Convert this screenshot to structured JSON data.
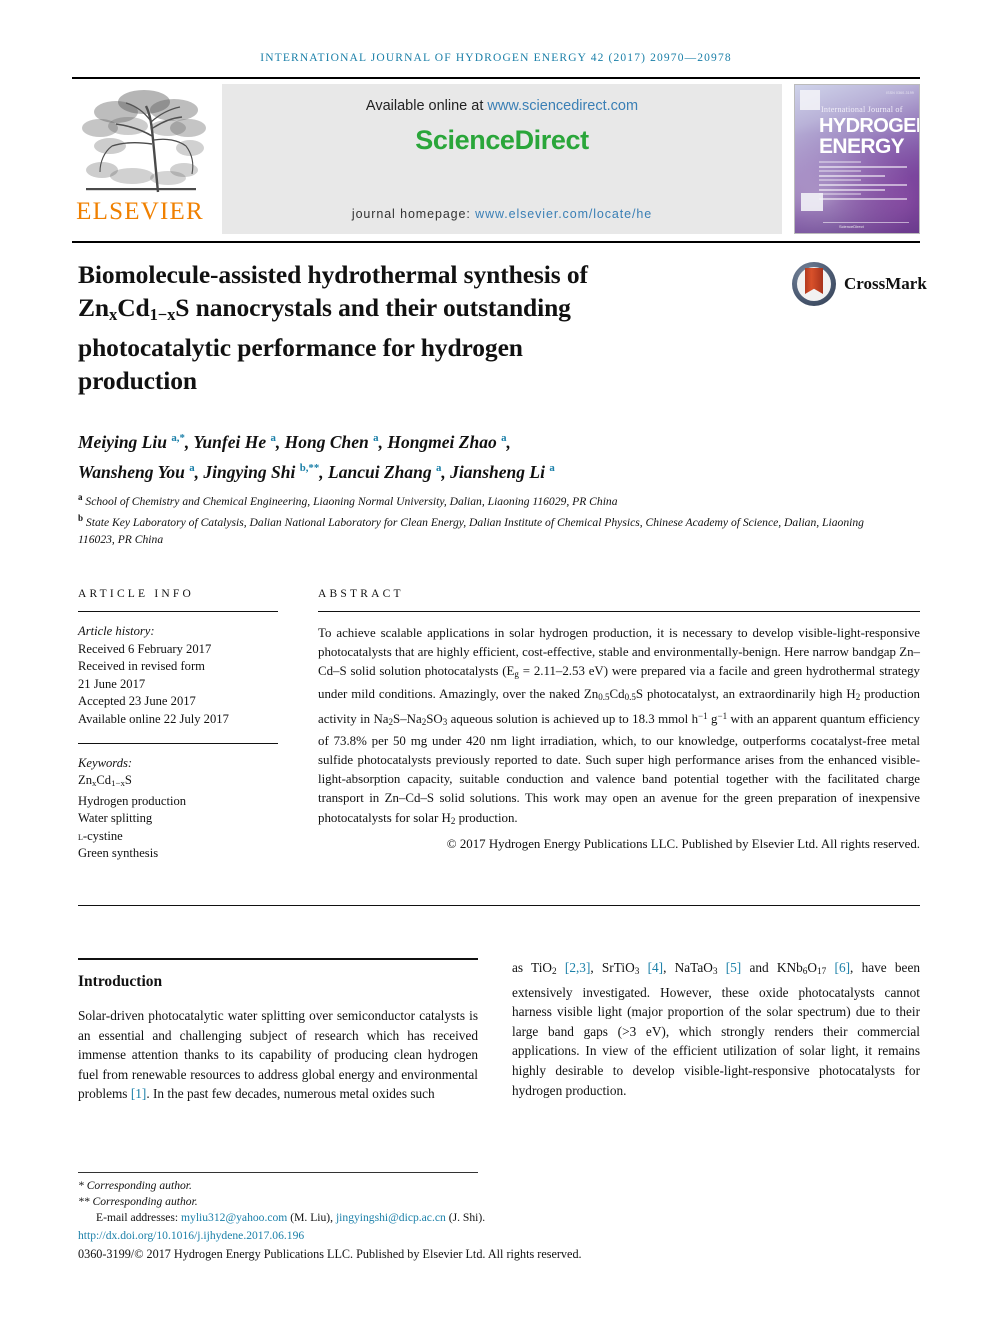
{
  "running_head": "International Journal of Hydrogen Energy 42 (2017) 20970—20978",
  "masthead": {
    "elsevier_wordmark": "ELSEVIER",
    "available_label": "Available online at ",
    "available_url": "www.sciencedirect.com",
    "sciencedirect_science": "Science",
    "sciencedirect_direct": "Direct",
    "homepage_label": "journal homepage: ",
    "homepage_url": "www.elsevier.com/locate/he",
    "cover": {
      "issn": "ISSN 0360-3199",
      "line1": "International Journal of",
      "line2": "HYDROGEN",
      "line3": "ENERGY",
      "publisher": "ScienceDirect"
    }
  },
  "article": {
    "title_line1": "Biomolecule-assisted hydrothermal synthesis of",
    "title_line2_a": "Zn",
    "title_line2_sub1": "x",
    "title_line2_b": "Cd",
    "title_line2_sub2": "1−x",
    "title_line2_c": "S nanocrystals and their outstanding",
    "title_line3": "photocatalytic performance for hydrogen",
    "title_line4": "production",
    "crossmark_label": "CrossMark"
  },
  "authors": {
    "line1": "Meiying Liu <sup>a,*</sup>, Yunfei He <sup>a</sup>, Hong Chen <sup>a</sup>, Hongmei Zhao <sup>a</sup>,",
    "line2": "Wansheng You <sup>a</sup>, Jingying Shi <sup>b,**</sup>, Lancui Zhang <sup>a</sup>, Jiansheng Li <sup>a</sup>"
  },
  "affiliations": {
    "a": "<sup>a</sup> School of Chemistry and Chemical Engineering, Liaoning Normal University, Dalian, Liaoning 116029, PR China",
    "b": "<sup>b</sup> State Key Laboratory of Catalysis, Dalian National Laboratory for Clean Energy, Dalian Institute of Chemical Physics, Chinese Academy of Science, Dalian, Liaoning 116023, PR China"
  },
  "article_info": {
    "heading": "ARTICLE INFO",
    "history_label": "Article history:",
    "received": "Received 6 February 2017",
    "revised_label": "Received in revised form",
    "revised_date": "21 June 2017",
    "accepted": "Accepted 23 June 2017",
    "available_online": "Available online 22 July 2017",
    "keywords_label": "Keywords:",
    "keywords": [
      "Zn<sub>x</sub>Cd<sub>1−x</sub>S",
      "Hydrogen production",
      "Water splitting",
      "<span class=\"smallcap\">l</span>-cystine",
      "Green synthesis"
    ]
  },
  "abstract": {
    "heading": "ABSTRACT",
    "body": "To achieve scalable applications in solar hydrogen production, it is necessary to develop visible-light-responsive photocatalysts that are highly efficient, cost-effective, stable and environmentally-benign. Here narrow bandgap Zn–Cd–S solid solution photocatalysts (E<sub>g</sub> = 2.11–2.53 eV) were prepared via a facile and green hydrothermal strategy under mild conditions. Amazingly, over the naked Zn<sub>0.5</sub>Cd<sub>0.5</sub>S photocatalyst, an extraordinarily high H<sub>2</sub> production activity in Na<sub>2</sub>S–Na<sub>2</sub>SO<sub>3</sub> aqueous solution is achieved up to 18.3 mmol h<sup>−1</sup> g<sup>−1</sup> with an apparent quantum efficiency of 73.8% per 50 mg under 420 nm light irradiation, which, to our knowledge, outperforms cocatalyst-free metal sulfide photocatalysts previously reported to date. Such super high performance arises from the enhanced visible-light-absorption capacity, suitable conduction and valence band potential together with the facilitated charge transport in Zn–Cd–S solid solutions. This work may open an avenue for the green preparation of inexpensive photocatalysts for solar H<sub>2</sub> production.",
    "copyright": "© 2017 Hydrogen Energy Publications LLC. Published by Elsevier Ltd. All rights reserved."
  },
  "introduction": {
    "heading": "Introduction",
    "left_paragraph": "Solar-driven photocatalytic water splitting over semiconductor catalysts is an essential and challenging subject of research which has received immense attention thanks to its capability of producing clean hydrogen fuel from renewable resources to address global energy and environmental problems <span class=\"ref\">[1]</span>. In the past few decades, numerous metal oxides such",
    "right_paragraph": "as TiO<sub>2</sub> <span class=\"ref\">[2,3]</span>, SrTiO<sub>3</sub> <span class=\"ref\">[4]</span>, NaTaO<sub>3</sub> <span class=\"ref\">[5]</span> and KNb<sub>6</sub>O<sub>17</sub> <span class=\"ref\">[6]</span>, have been extensively investigated. However, these oxide photocatalysts cannot harness visible light (major proportion of the solar spectrum) due to their large band gaps (&gt;3 eV), which strongly renders their commercial applications. In view of the efficient utilization of solar light, it remains highly desirable to develop visible-light-responsive photocatalysts for hydrogen production."
  },
  "footer": {
    "corresponding_1": "* Corresponding author.",
    "corresponding_2": "** Corresponding author.",
    "email_label": "E-mail addresses: ",
    "email_1": "myliu312@yahoo.com",
    "email_1_name": " (M. Liu), ",
    "email_2": "jingyingshi@dicp.ac.cn",
    "email_2_name": " (J. Shi).",
    "doi": "http://dx.doi.org/10.1016/j.ijhydene.2017.06.196",
    "issn_line": "0360-3199/© 2017 Hydrogen Energy Publications LLC. Published by Elsevier Ltd. All rights reserved."
  },
  "colors": {
    "link_blue": "#1a7fa8",
    "sciencedirect_green": "#2aa63a",
    "elsevier_orange": "#f08000"
  }
}
